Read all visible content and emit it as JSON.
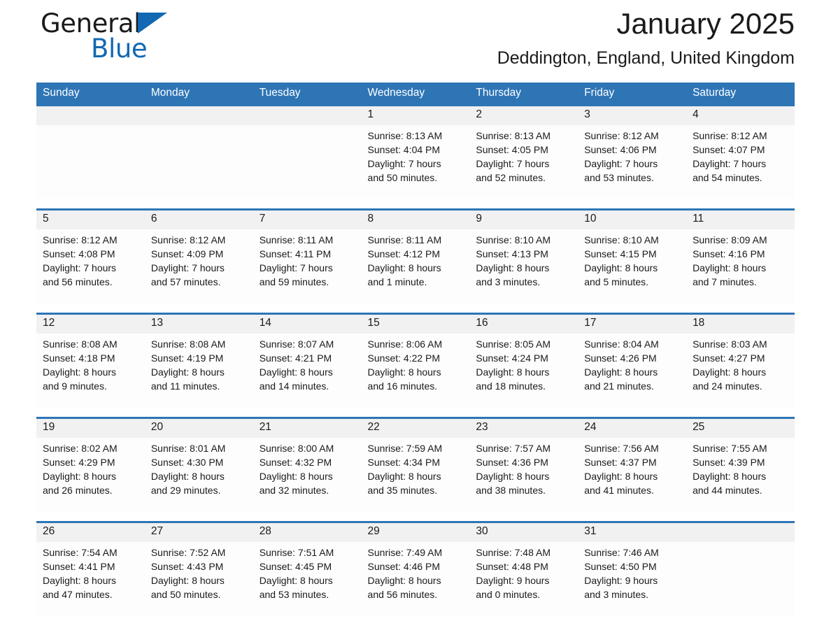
{
  "brand": {
    "word1": "General",
    "word2": "Blue",
    "triangle_color": "#1268b3"
  },
  "header": {
    "title": "January 2025",
    "subtitle": "Deddington, England, United Kingdom",
    "accent_color": "#2e75b6"
  },
  "calendar": {
    "weekday_headers": [
      "Sunday",
      "Monday",
      "Tuesday",
      "Wednesday",
      "Thursday",
      "Friday",
      "Saturday"
    ],
    "weeks": [
      {
        "days": [
          {
            "number": "",
            "lines": []
          },
          {
            "number": "",
            "lines": []
          },
          {
            "number": "",
            "lines": []
          },
          {
            "number": "1",
            "lines": [
              "Sunrise: 8:13 AM",
              "Sunset: 4:04 PM",
              "Daylight: 7 hours",
              "and 50 minutes."
            ]
          },
          {
            "number": "2",
            "lines": [
              "Sunrise: 8:13 AM",
              "Sunset: 4:05 PM",
              "Daylight: 7 hours",
              "and 52 minutes."
            ]
          },
          {
            "number": "3",
            "lines": [
              "Sunrise: 8:12 AM",
              "Sunset: 4:06 PM",
              "Daylight: 7 hours",
              "and 53 minutes."
            ]
          },
          {
            "number": "4",
            "lines": [
              "Sunrise: 8:12 AM",
              "Sunset: 4:07 PM",
              "Daylight: 7 hours",
              "and 54 minutes."
            ]
          }
        ]
      },
      {
        "days": [
          {
            "number": "5",
            "lines": [
              "Sunrise: 8:12 AM",
              "Sunset: 4:08 PM",
              "Daylight: 7 hours",
              "and 56 minutes."
            ]
          },
          {
            "number": "6",
            "lines": [
              "Sunrise: 8:12 AM",
              "Sunset: 4:09 PM",
              "Daylight: 7 hours",
              "and 57 minutes."
            ]
          },
          {
            "number": "7",
            "lines": [
              "Sunrise: 8:11 AM",
              "Sunset: 4:11 PM",
              "Daylight: 7 hours",
              "and 59 minutes."
            ]
          },
          {
            "number": "8",
            "lines": [
              "Sunrise: 8:11 AM",
              "Sunset: 4:12 PM",
              "Daylight: 8 hours",
              "and 1 minute."
            ]
          },
          {
            "number": "9",
            "lines": [
              "Sunrise: 8:10 AM",
              "Sunset: 4:13 PM",
              "Daylight: 8 hours",
              "and 3 minutes."
            ]
          },
          {
            "number": "10",
            "lines": [
              "Sunrise: 8:10 AM",
              "Sunset: 4:15 PM",
              "Daylight: 8 hours",
              "and 5 minutes."
            ]
          },
          {
            "number": "11",
            "lines": [
              "Sunrise: 8:09 AM",
              "Sunset: 4:16 PM",
              "Daylight: 8 hours",
              "and 7 minutes."
            ]
          }
        ]
      },
      {
        "days": [
          {
            "number": "12",
            "lines": [
              "Sunrise: 8:08 AM",
              "Sunset: 4:18 PM",
              "Daylight: 8 hours",
              "and 9 minutes."
            ]
          },
          {
            "number": "13",
            "lines": [
              "Sunrise: 8:08 AM",
              "Sunset: 4:19 PM",
              "Daylight: 8 hours",
              "and 11 minutes."
            ]
          },
          {
            "number": "14",
            "lines": [
              "Sunrise: 8:07 AM",
              "Sunset: 4:21 PM",
              "Daylight: 8 hours",
              "and 14 minutes."
            ]
          },
          {
            "number": "15",
            "lines": [
              "Sunrise: 8:06 AM",
              "Sunset: 4:22 PM",
              "Daylight: 8 hours",
              "and 16 minutes."
            ]
          },
          {
            "number": "16",
            "lines": [
              "Sunrise: 8:05 AM",
              "Sunset: 4:24 PM",
              "Daylight: 8 hours",
              "and 18 minutes."
            ]
          },
          {
            "number": "17",
            "lines": [
              "Sunrise: 8:04 AM",
              "Sunset: 4:26 PM",
              "Daylight: 8 hours",
              "and 21 minutes."
            ]
          },
          {
            "number": "18",
            "lines": [
              "Sunrise: 8:03 AM",
              "Sunset: 4:27 PM",
              "Daylight: 8 hours",
              "and 24 minutes."
            ]
          }
        ]
      },
      {
        "days": [
          {
            "number": "19",
            "lines": [
              "Sunrise: 8:02 AM",
              "Sunset: 4:29 PM",
              "Daylight: 8 hours",
              "and 26 minutes."
            ]
          },
          {
            "number": "20",
            "lines": [
              "Sunrise: 8:01 AM",
              "Sunset: 4:30 PM",
              "Daylight: 8 hours",
              "and 29 minutes."
            ]
          },
          {
            "number": "21",
            "lines": [
              "Sunrise: 8:00 AM",
              "Sunset: 4:32 PM",
              "Daylight: 8 hours",
              "and 32 minutes."
            ]
          },
          {
            "number": "22",
            "lines": [
              "Sunrise: 7:59 AM",
              "Sunset: 4:34 PM",
              "Daylight: 8 hours",
              "and 35 minutes."
            ]
          },
          {
            "number": "23",
            "lines": [
              "Sunrise: 7:57 AM",
              "Sunset: 4:36 PM",
              "Daylight: 8 hours",
              "and 38 minutes."
            ]
          },
          {
            "number": "24",
            "lines": [
              "Sunrise: 7:56 AM",
              "Sunset: 4:37 PM",
              "Daylight: 8 hours",
              "and 41 minutes."
            ]
          },
          {
            "number": "25",
            "lines": [
              "Sunrise: 7:55 AM",
              "Sunset: 4:39 PM",
              "Daylight: 8 hours",
              "and 44 minutes."
            ]
          }
        ]
      },
      {
        "days": [
          {
            "number": "26",
            "lines": [
              "Sunrise: 7:54 AM",
              "Sunset: 4:41 PM",
              "Daylight: 8 hours",
              "and 47 minutes."
            ]
          },
          {
            "number": "27",
            "lines": [
              "Sunrise: 7:52 AM",
              "Sunset: 4:43 PM",
              "Daylight: 8 hours",
              "and 50 minutes."
            ]
          },
          {
            "number": "28",
            "lines": [
              "Sunrise: 7:51 AM",
              "Sunset: 4:45 PM",
              "Daylight: 8 hours",
              "and 53 minutes."
            ]
          },
          {
            "number": "29",
            "lines": [
              "Sunrise: 7:49 AM",
              "Sunset: 4:46 PM",
              "Daylight: 8 hours",
              "and 56 minutes."
            ]
          },
          {
            "number": "30",
            "lines": [
              "Sunrise: 7:48 AM",
              "Sunset: 4:48 PM",
              "Daylight: 9 hours",
              "and 0 minutes."
            ]
          },
          {
            "number": "31",
            "lines": [
              "Sunrise: 7:46 AM",
              "Sunset: 4:50 PM",
              "Daylight: 9 hours",
              "and 3 minutes."
            ]
          },
          {
            "number": "",
            "lines": []
          }
        ]
      }
    ]
  }
}
